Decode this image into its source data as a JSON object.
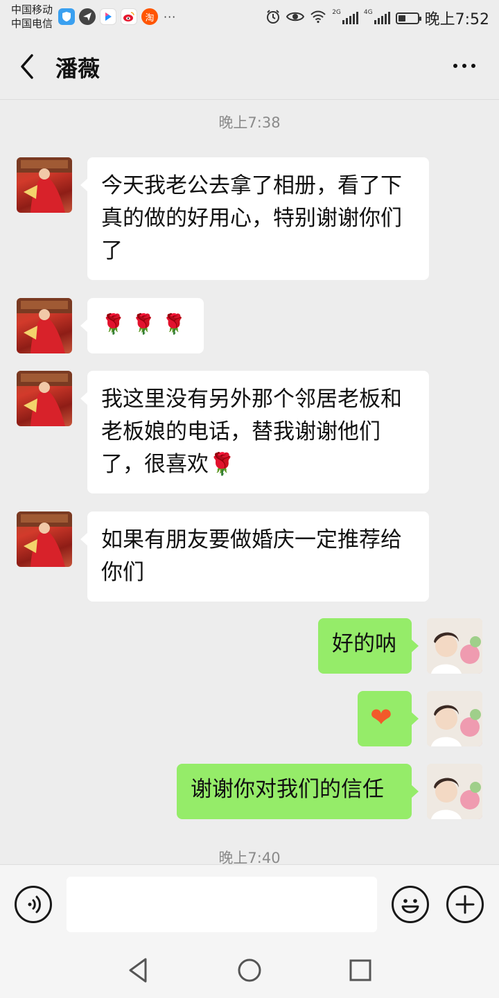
{
  "status_bar": {
    "carrier_1": "中国移动",
    "carrier_2": "中国电信",
    "app_icons": [
      {
        "name": "shield-app-icon",
        "color": "#3aa0f0"
      },
      {
        "name": "paper-plane-app-icon",
        "color": "#444444"
      },
      {
        "name": "youku-app-icon",
        "color": "#1f8fff"
      },
      {
        "name": "weibo-app-icon",
        "color": "#e6162d"
      },
      {
        "name": "taobao-app-icon",
        "color": "#ff5500",
        "glyph": "淘"
      }
    ],
    "more_indicator": "···",
    "net_2g": "2G",
    "net_4g": "4G",
    "time": "晚上7:52"
  },
  "header": {
    "title": "潘薇"
  },
  "chat": {
    "timestamp_1": "晚上7:38",
    "messages": [
      {
        "side": "left",
        "text": "今天我老公去拿了相册，看了下真的做的好用心，特别谢谢你们了"
      },
      {
        "side": "left",
        "text": "🌹 🌹 🌹"
      },
      {
        "side": "left",
        "text": "我这里没有另外那个邻居老板和老板娘的电话，替我谢谢他们了，很喜欢🌹"
      },
      {
        "side": "left",
        "text": "如果有朋友要做婚庆一定推荐给你们"
      },
      {
        "side": "right",
        "text": "好的呐"
      },
      {
        "side": "right",
        "text": "❤"
      },
      {
        "side": "right",
        "text": "谢谢你对我们的信任"
      }
    ],
    "timestamp_2": "晚上7:40"
  },
  "input_bar": {
    "value": "",
    "placeholder": ""
  },
  "colors": {
    "background": "#ededed",
    "outgoing_bubble": "#95ec69",
    "incoming_bubble": "#ffffff"
  }
}
